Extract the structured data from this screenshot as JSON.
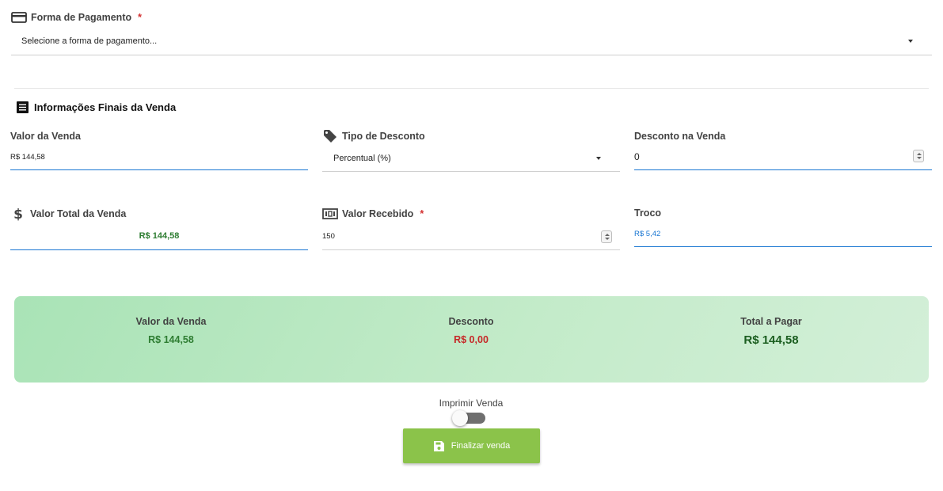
{
  "payment": {
    "label": "Forma de Pagamento",
    "required_mark": "*",
    "select_value": "Selecione a forma de pagamento..."
  },
  "section": {
    "title": "Informações Finais da Venda"
  },
  "fields": {
    "valor_venda": {
      "label": "Valor da Venda",
      "value": "R$ 144,58"
    },
    "tipo_desconto": {
      "label": "Tipo de Desconto",
      "value": "Percentual (%)"
    },
    "desconto_venda": {
      "label": "Desconto na Venda",
      "value": "0"
    },
    "valor_total": {
      "label": "Valor Total da Venda",
      "value": "R$ 144,58"
    },
    "valor_recebido": {
      "label": "Valor Recebido",
      "required_mark": "*",
      "value": "150"
    },
    "troco": {
      "label": "Troco",
      "value": "R$ 5,42"
    }
  },
  "summary": {
    "venda_label": "Valor da Venda",
    "venda_value": "R$ 144,58",
    "desconto_label": "Desconto",
    "desconto_value": "R$ 0,00",
    "total_label": "Total a Pagar",
    "total_value": "R$ 144,58"
  },
  "print": {
    "label": "Imprimir Venda",
    "enabled": false
  },
  "finalize_button": {
    "label": "Finalizar venda"
  },
  "colors": {
    "accent_green": "#8bc34a",
    "value_green": "#2e7d32",
    "discount_red": "#c62828",
    "link_blue": "#1976d2"
  }
}
